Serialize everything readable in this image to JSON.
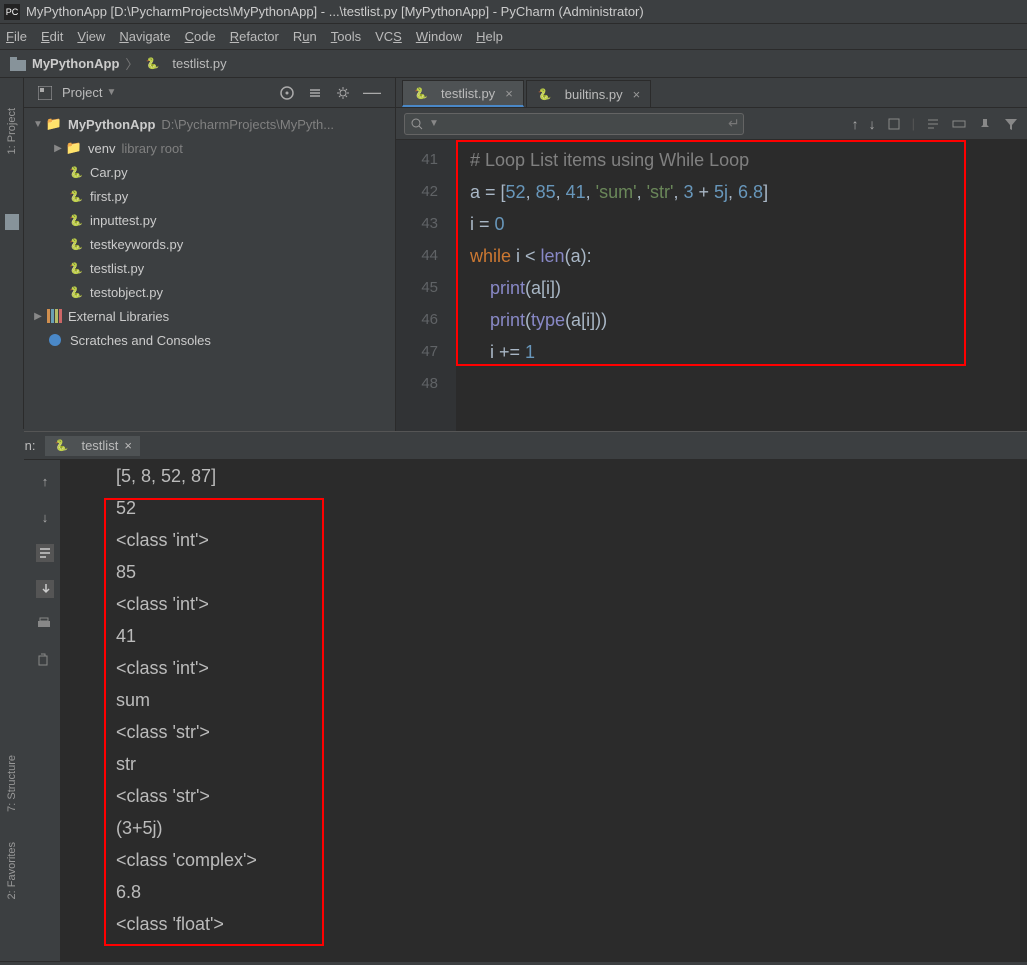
{
  "title": "MyPythonApp [D:\\PycharmProjects\\MyPythonApp] - ...\\testlist.py [MyPythonApp] - PyCharm (Administrator)",
  "menu": [
    "File",
    "Edit",
    "View",
    "Navigate",
    "Code",
    "Refactor",
    "Run",
    "Tools",
    "VCS",
    "Window",
    "Help"
  ],
  "breadcrumb": {
    "project": "MyPythonApp",
    "file": "testlist.py"
  },
  "projectPanel": {
    "label": "Project"
  },
  "tree": {
    "root": {
      "name": "MyPythonApp",
      "path": "D:\\PycharmProjects\\MyPyth..."
    },
    "venv": {
      "name": "venv",
      "tag": "library root"
    },
    "files": [
      "Car.py",
      "first.py",
      "inputtest.py",
      "testkeywords.py",
      "testlist.py",
      "testobject.py"
    ],
    "ext": "External Libraries",
    "scratch": "Scratches and Consoles"
  },
  "tabs": [
    {
      "name": "testlist.py",
      "active": true
    },
    {
      "name": "builtins.py",
      "active": false
    }
  ],
  "search": {
    "placeholder": ""
  },
  "gutter": [
    "41",
    "42",
    "43",
    "44",
    "45",
    "46",
    "47",
    "48"
  ],
  "code": {
    "l1": "# Loop List items using While Loop",
    "l2a": "a = [",
    "l2n1": "52",
    "l2c": ", ",
    "l2n2": "85",
    "l2n3": "41",
    "l2s1": "'sum'",
    "l2s2": "'str'",
    "l2n4": "3",
    "l2p": " + ",
    "l2n5": "5j",
    "l2n6": "6.8",
    "l2end": "]",
    "l3a": "i = ",
    "l3n": "0",
    "l4a": "while ",
    "l4b": "i < ",
    "l4c": "len",
    "l4d": "(a):",
    "l5a": "print",
    "l5b": "(a[i])",
    "l6a": "print",
    "l6b": "(",
    "l6c": "type",
    "l6d": "(a[i]))",
    "l7a": "i += ",
    "l7n": "1"
  },
  "run": {
    "label": "Run:",
    "tab": "testlist"
  },
  "output": [
    "[5, 8, 52, 87]",
    "52",
    "<class 'int'>",
    "85",
    "<class 'int'>",
    "41",
    "<class 'int'>",
    "sum",
    "<class 'str'>",
    "str",
    "<class 'str'>",
    "(3+5j)",
    "<class 'complex'>",
    "6.8",
    "<class 'float'>"
  ],
  "sidebars": {
    "project": "1: Project",
    "structure": "7: Structure",
    "favorites": "2: Favorites"
  }
}
